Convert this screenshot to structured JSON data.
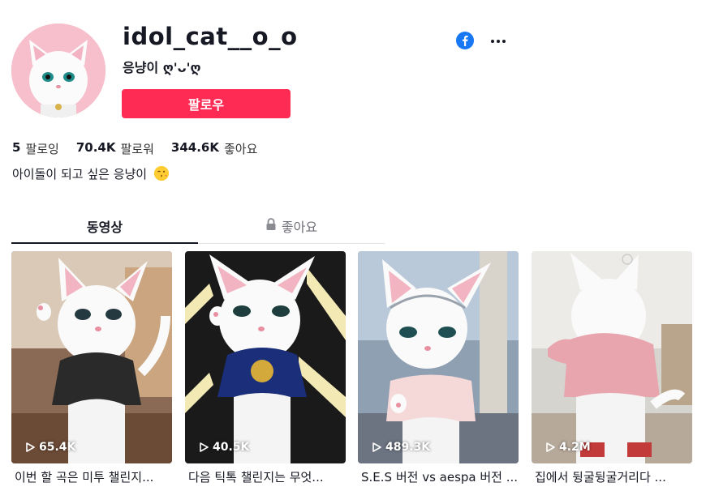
{
  "profile": {
    "username": "idol_cat__o_o",
    "nickname": "응냥이 ღ'ᴗ'ღ",
    "follow_label": "팔로우",
    "bio": "아이돌이 되고 싶은 응냥이"
  },
  "stats": {
    "following_count": "5",
    "following_label": "팔로잉",
    "followers_count": "70.4K",
    "followers_label": "팔로워",
    "likes_count": "344.6K",
    "likes_label": "좋아요"
  },
  "tabs": {
    "videos_label": "동영상",
    "liked_label": "좋아요"
  },
  "videos": [
    {
      "views": "65.4K",
      "caption": "이번 할 곡은 미투 챌린지..."
    },
    {
      "views": "40.5K",
      "caption": "다음 틱톡 챌린지는 무엇..."
    },
    {
      "views": "489.3K",
      "caption": "S.E.S 버전 vs aespa 버전 ..."
    },
    {
      "views": "4.2M",
      "caption": "집에서 뒹굴뒹굴거리다 ..."
    }
  ],
  "colors": {
    "accent": "#fe2c55",
    "facebook": "#1877f2"
  },
  "icons": {
    "share": "facebook-icon",
    "more": "more-options-icon",
    "lock": "lock-icon",
    "play": "play-icon"
  }
}
